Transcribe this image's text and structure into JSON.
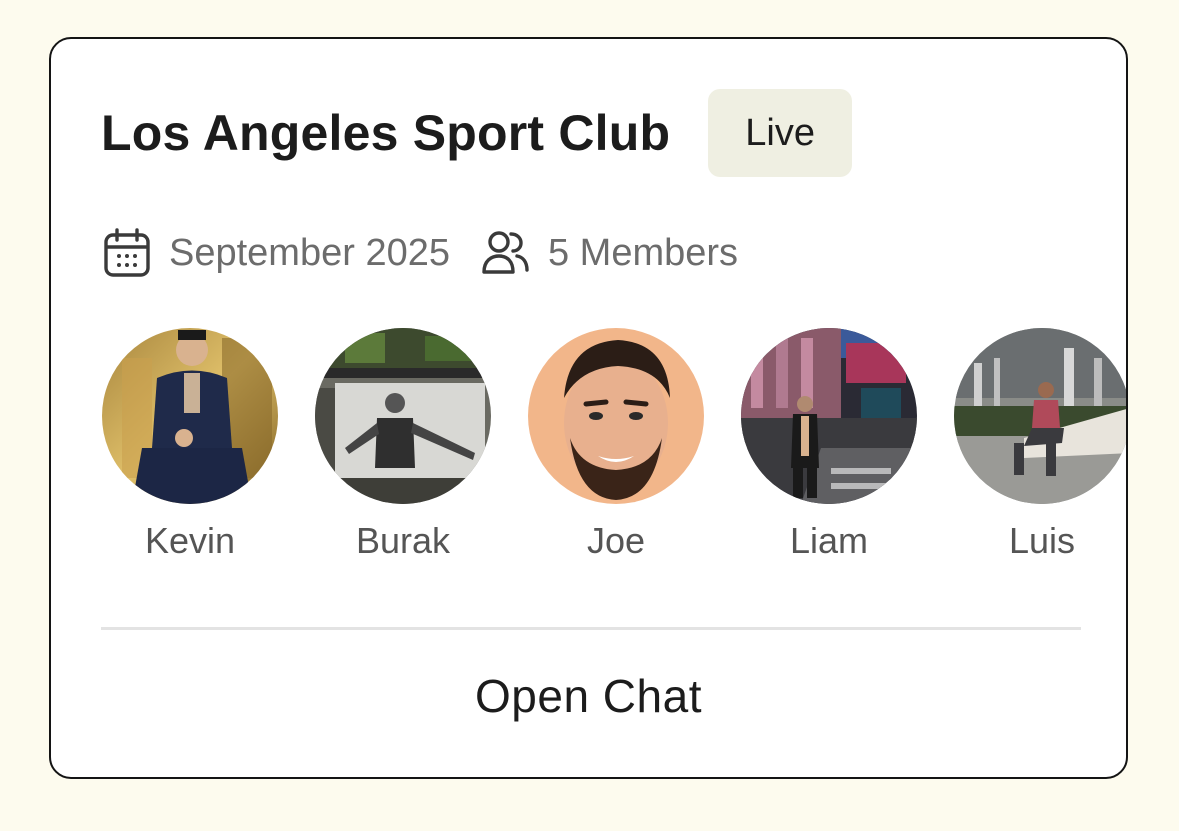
{
  "card": {
    "title": "Los Angeles Sport Club",
    "status_badge": "Live",
    "date": "September 2025",
    "members_count": "5 Members",
    "open_chat_label": "Open Chat"
  },
  "icons": {
    "date": "calendar-icon",
    "members": "users-icon"
  },
  "members": [
    {
      "name": "Kevin",
      "avatar": "photo-man-in-navy-suit-on-gold-background"
    },
    {
      "name": "Burak",
      "avatar": "photo-man-pointing-black-and-white"
    },
    {
      "name": "Joe",
      "avatar": "photo-smiling-man-with-beard-peach-background"
    },
    {
      "name": "Liam",
      "avatar": "photo-man-on-city-street-at-night"
    },
    {
      "name": "Luis",
      "avatar": "photo-man-sitting-on-rooftop"
    }
  ],
  "colors": {
    "page_background": "#fdfbee",
    "card_border": "#141414",
    "badge_background": "#efefe2",
    "muted_text": "#6c6c6c"
  }
}
